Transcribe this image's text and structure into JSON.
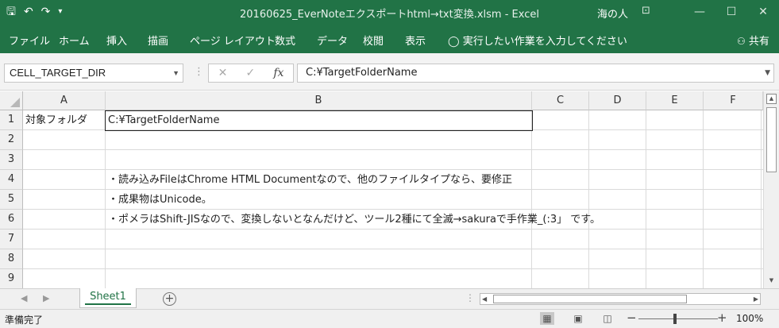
{
  "window": {
    "title": "20160625_EverNoteエクスポートhtml→txt変換.xlsm - Excel",
    "user": "海の人",
    "quick_access": {
      "save_icon": "save-icon",
      "undo_icon": "undo-icon",
      "redo_icon": "redo-icon",
      "customize_icon": "customize-qat-icon"
    },
    "controls": {
      "ribbon_options": "⊡",
      "minimize": "—",
      "maximize": "☐",
      "close": "✕"
    }
  },
  "ribbon": {
    "tabs": [
      "ファイル",
      "ホーム",
      "挿入",
      "描画",
      "ページ レイアウト",
      "数式",
      "データ",
      "校閲",
      "表示"
    ],
    "tell_me": "実行したい作業を入力してください",
    "share": "共有"
  },
  "formula_bar": {
    "name_box": "CELL_TARGET_DIR",
    "cancel_symbol": "✕",
    "enter_symbol": "✓",
    "function_symbol": "fx",
    "formula": "C:¥TargetFolderName"
  },
  "grid": {
    "columns": [
      "A",
      "B",
      "C",
      "D",
      "E",
      "F"
    ],
    "rows": [
      "1",
      "2",
      "3",
      "4",
      "5",
      "6",
      "7",
      "8",
      "9"
    ],
    "cells": {
      "A1": "対象フォルダ",
      "B1": "C:¥TargetFolderName",
      "B4": "・読み込みFileはChrome HTML Documentなので、他のファイルタイプなら、要修正",
      "B5": "・成果物はUnicode。",
      "B6": "・ポメラはShift-JISなので、変換しないとなんだけど、ツール2種にて全滅→sakuraで手作業_(:3」 です。"
    }
  },
  "sheets": {
    "tabs": [
      "Sheet1"
    ],
    "active": "Sheet1",
    "add_symbol": "+"
  },
  "status_bar": {
    "ready": "準備完了",
    "zoom": "100%",
    "zoom_minus": "−",
    "zoom_plus": "+"
  }
}
